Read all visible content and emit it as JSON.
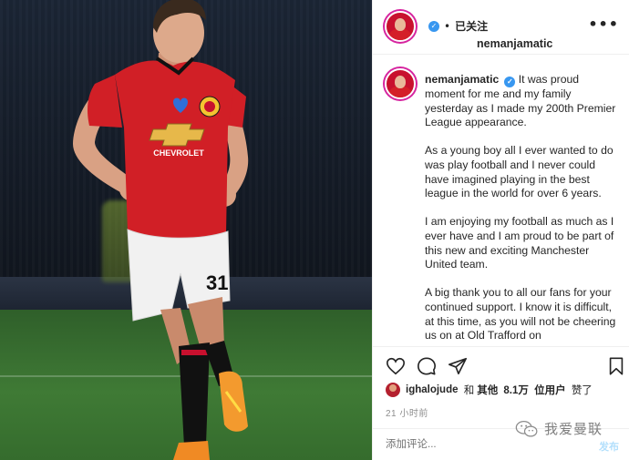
{
  "post": {
    "username": "nemanjamatic",
    "follow_label": "已关注",
    "separator": "•",
    "more_label": "•••",
    "caption": {
      "username": "nemanjamatic",
      "paragraphs": [
        "It was proud moment for me and my family yesterday as I made my 200th Premier League appearance.",
        "As a young boy all I ever wanted to do was play football and I never could have imagined playing in the best league in the world for over 6 years.",
        "I am enjoying my football as much as I ever have and I am proud to be part of this new and exciting Manchester United team.",
        "A big thank you to all our fans for your continued support. I know it is difficult, at this time, as you will not be cheering us on at Old Trafford on"
      ]
    },
    "likes": {
      "liker": "ighalojude",
      "and_label": "和",
      "others_label": "其他",
      "count": "8.1万",
      "users_label": "位用户",
      "liked_label": "赞了"
    },
    "time": "21 小时前",
    "comment": {
      "placeholder": "添加评论...",
      "post_label": "发布"
    },
    "watermark_text": "我爱曼联"
  },
  "photo": {
    "shirt_sponsor": "CHEVROLET",
    "shorts_number": "31"
  },
  "icons": {
    "like": "heart-icon",
    "comment": "comment-icon",
    "share": "paper-plane-icon",
    "save": "bookmark-icon",
    "verified": "verified-badge-icon",
    "watermark": "wechat-icon"
  },
  "colors": {
    "verified": "#3897f0",
    "story_ring": "#d6249f",
    "post_button": "#b2dffc",
    "muted_text": "#8e8e8e",
    "shirt_red": "#d11f26"
  }
}
